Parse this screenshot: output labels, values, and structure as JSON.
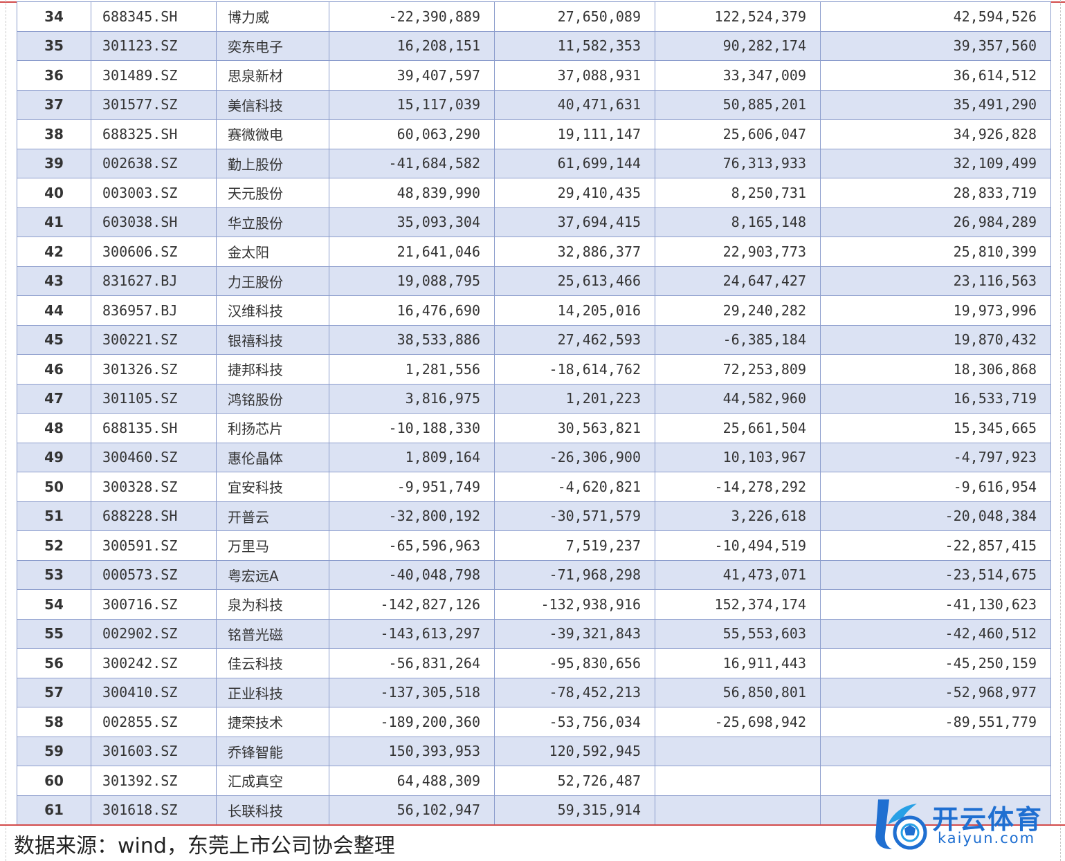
{
  "table": {
    "rows": [
      [
        "34",
        "688345.SH",
        "博力威",
        "-22,390,889",
        "27,650,089",
        "122,524,379",
        "42,594,526"
      ],
      [
        "35",
        "301123.SZ",
        "奕东电子",
        "16,208,151",
        "11,582,353",
        "90,282,174",
        "39,357,560"
      ],
      [
        "36",
        "301489.SZ",
        "思泉新材",
        "39,407,597",
        "37,088,931",
        "33,347,009",
        "36,614,512"
      ],
      [
        "37",
        "301577.SZ",
        "美信科技",
        "15,117,039",
        "40,471,631",
        "50,885,201",
        "35,491,290"
      ],
      [
        "38",
        "688325.SH",
        "赛微微电",
        "60,063,290",
        "19,111,147",
        "25,606,047",
        "34,926,828"
      ],
      [
        "39",
        "002638.SZ",
        "勤上股份",
        "-41,684,582",
        "61,699,144",
        "76,313,933",
        "32,109,499"
      ],
      [
        "40",
        "003003.SZ",
        "天元股份",
        "48,839,990",
        "29,410,435",
        "8,250,731",
        "28,833,719"
      ],
      [
        "41",
        "603038.SH",
        "华立股份",
        "35,093,304",
        "37,694,415",
        "8,165,148",
        "26,984,289"
      ],
      [
        "42",
        "300606.SZ",
        "金太阳",
        "21,641,046",
        "32,886,377",
        "22,903,773",
        "25,810,399"
      ],
      [
        "43",
        "831627.BJ",
        "力王股份",
        "19,088,795",
        "25,613,466",
        "24,647,427",
        "23,116,563"
      ],
      [
        "44",
        "836957.BJ",
        "汉维科技",
        "16,476,690",
        "14,205,016",
        "29,240,282",
        "19,973,996"
      ],
      [
        "45",
        "300221.SZ",
        "银禧科技",
        "38,533,886",
        "27,462,593",
        "-6,385,184",
        "19,870,432"
      ],
      [
        "46",
        "301326.SZ",
        "捷邦科技",
        "1,281,556",
        "-18,614,762",
        "72,253,809",
        "18,306,868"
      ],
      [
        "47",
        "301105.SZ",
        "鸿铭股份",
        "3,816,975",
        "1,201,223",
        "44,582,960",
        "16,533,719"
      ],
      [
        "48",
        "688135.SH",
        "利扬芯片",
        "-10,188,330",
        "30,563,821",
        "25,661,504",
        "15,345,665"
      ],
      [
        "49",
        "300460.SZ",
        "惠伦晶体",
        "1,809,164",
        "-26,306,900",
        "10,103,967",
        "-4,797,923"
      ],
      [
        "50",
        "300328.SZ",
        "宜安科技",
        "-9,951,749",
        "-4,620,821",
        "-14,278,292",
        "-9,616,954"
      ],
      [
        "51",
        "688228.SH",
        "开普云",
        "-32,800,192",
        "-30,571,579",
        "3,226,618",
        "-20,048,384"
      ],
      [
        "52",
        "300591.SZ",
        "万里马",
        "-65,596,963",
        "7,519,237",
        "-10,494,519",
        "-22,857,415"
      ],
      [
        "53",
        "000573.SZ",
        "粤宏远A",
        "-40,048,798",
        "-71,968,298",
        "41,473,071",
        "-23,514,675"
      ],
      [
        "54",
        "300716.SZ",
        "泉为科技",
        "-142,827,126",
        "-132,938,916",
        "152,374,174",
        "-41,130,623"
      ],
      [
        "55",
        "002902.SZ",
        "铭普光磁",
        "-143,613,297",
        "-39,321,843",
        "55,553,603",
        "-42,460,512"
      ],
      [
        "56",
        "300242.SZ",
        "佳云科技",
        "-56,831,264",
        "-95,830,656",
        "16,911,443",
        "-45,250,159"
      ],
      [
        "57",
        "300410.SZ",
        "正业科技",
        "-137,305,518",
        "-78,452,213",
        "56,850,801",
        "-52,968,977"
      ],
      [
        "58",
        "002855.SZ",
        "捷荣技术",
        "-189,200,360",
        "-53,756,034",
        "-25,698,942",
        "-89,551,779"
      ],
      [
        "59",
        "301603.SZ",
        "乔锋智能",
        "150,393,953",
        "120,592,945",
        "",
        ""
      ],
      [
        "60",
        "301392.SZ",
        "汇成真空",
        "64,488,309",
        "52,726,487",
        "",
        ""
      ],
      [
        "61",
        "301618.SZ",
        "长联科技",
        "56,102,947",
        "59,315,914",
        "",
        ""
      ]
    ]
  },
  "footer": {
    "source": "数据来源：wind，东莞上市公司协会整理"
  },
  "watermark": {
    "brand_cn": "开云体育",
    "brand_en": "kaiyun.com",
    "logo_icon": "kaiyun-logo-icon",
    "colors": {
      "brand": "#1f6fd1",
      "rule": "#d24a4a",
      "row_alt": "#dbe2f3",
      "border": "#8b9ccc"
    }
  }
}
